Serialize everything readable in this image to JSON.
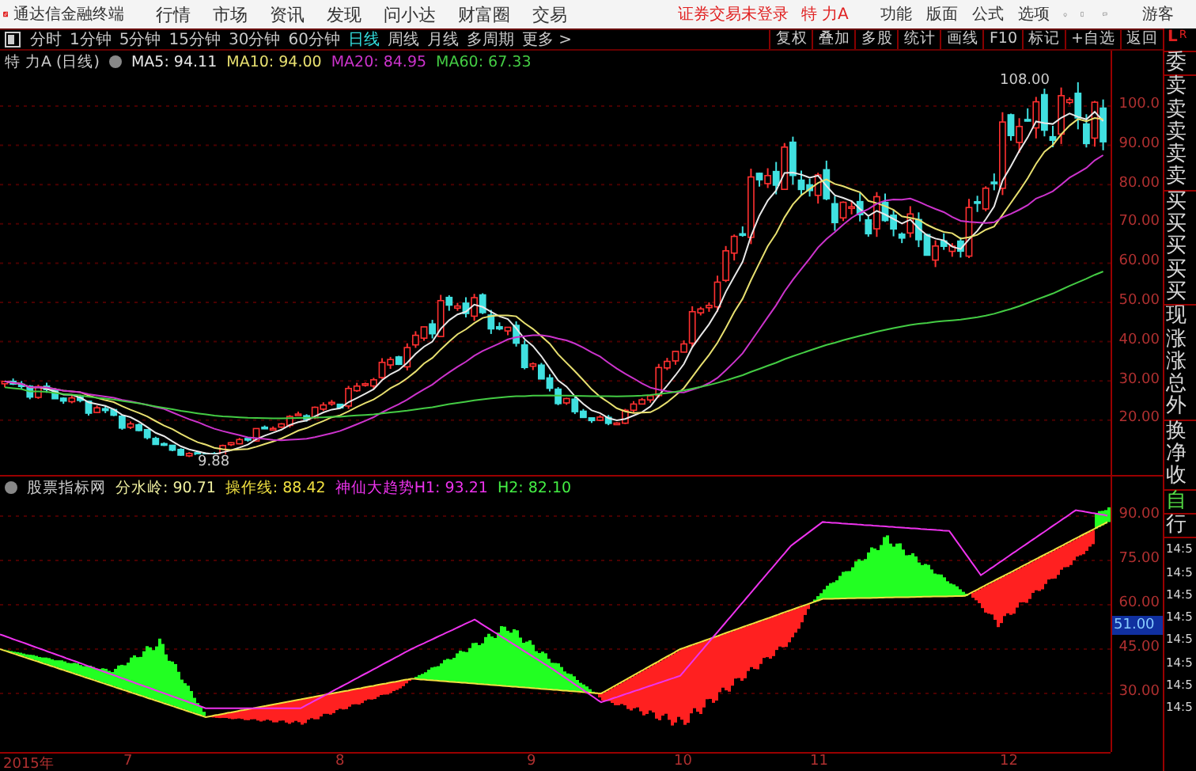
{
  "app": {
    "title": "通达信金融终端"
  },
  "menu": [
    "行情",
    "市场",
    "资讯",
    "发现",
    "问小达",
    "财富圈",
    "交易"
  ],
  "login_status": "证券交易未登录",
  "current_stock": "特 力A",
  "top_actions": [
    "功能",
    "版面",
    "公式",
    "选项"
  ],
  "user": "游客",
  "periods": [
    {
      "label": "分时",
      "selected": false
    },
    {
      "label": "1分钟",
      "selected": false
    },
    {
      "label": "5分钟",
      "selected": false
    },
    {
      "label": "15分钟",
      "selected": false
    },
    {
      "label": "30分钟",
      "selected": false
    },
    {
      "label": "60分钟",
      "selected": false
    },
    {
      "label": "日线",
      "selected": true
    },
    {
      "label": "周线",
      "selected": false
    },
    {
      "label": "月线",
      "selected": false
    },
    {
      "label": "多周期",
      "selected": false
    },
    {
      "label": "更多 >",
      "selected": false
    }
  ],
  "tools": [
    "复权",
    "叠加",
    "多股",
    "统计",
    "画线",
    "F10",
    "标记",
    "+自选",
    "返回"
  ],
  "price_chart": {
    "stock_label": "特 力A (日线)",
    "moving_averages": [
      {
        "label": "MA5: 94.11",
        "color": "#e8e8e8"
      },
      {
        "label": "MA10: 94.00",
        "color": "#e8e070"
      },
      {
        "label": "MA20: 84.95",
        "color": "#cc33cc"
      },
      {
        "label": "MA60: 67.33",
        "color": "#44cc44"
      }
    ],
    "axis_labels": [
      "100.0",
      "90.00",
      "80.00",
      "70.00",
      "60.00",
      "50.00",
      "40.00",
      "30.00",
      "20.00"
    ],
    "high_label": "108.00",
    "low_label": "9.88"
  },
  "indicator": {
    "source": "股票指标网",
    "lines": [
      {
        "label": "分水岭: 90.71",
        "color": "#f0f0a0"
      },
      {
        "label": "操作线: 88.42",
        "color": "#f0e040"
      },
      {
        "label": "神仙大趋势H1: 93.21",
        "color": "#ee33ee"
      },
      {
        "label": "H2: 82.10",
        "color": "#44ee44"
      }
    ],
    "axis_labels": [
      "90.00",
      "75.00",
      "60.00",
      "45.00",
      "30.00"
    ],
    "current_value": "51.00"
  },
  "date_axis": [
    "2015年",
    "7",
    "8",
    "9",
    "10",
    "11",
    "12"
  ],
  "side_panel": {
    "corner": [
      "L",
      "R"
    ],
    "groups": [
      {
        "kind": "label",
        "items": [
          "委"
        ]
      },
      {
        "kind": "label",
        "items": [
          "卖",
          "卖",
          "卖",
          "卖",
          "卖"
        ]
      },
      {
        "kind": "label",
        "items": [
          "买",
          "买",
          "买",
          "买",
          "买"
        ]
      },
      {
        "kind": "label",
        "items": [
          "现",
          "涨",
          "涨",
          "总",
          "外"
        ]
      },
      {
        "kind": "label",
        "items": [
          "换",
          "净",
          "收"
        ]
      },
      {
        "kind": "status",
        "items": [
          "自"
        ]
      },
      {
        "kind": "label",
        "items": [
          "行"
        ]
      },
      {
        "kind": "time",
        "items": [
          "14:5",
          "14:5",
          "14:5",
          "14:5",
          "14:5",
          "14:5",
          "14:5",
          "14:5"
        ]
      }
    ]
  }
}
